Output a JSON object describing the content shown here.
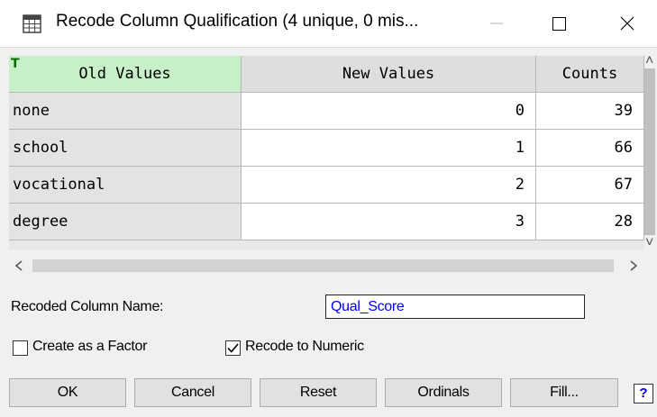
{
  "window": {
    "title": "Recode Column Qualification (4 unique, 0 mis...",
    "icons": {
      "app": "table-icon",
      "minimize": "minimize-icon",
      "maximize": "maximize-icon",
      "close": "close-icon"
    }
  },
  "grid": {
    "headers": {
      "old": "Old Values",
      "new": "New Values",
      "counts": "Counts"
    },
    "type_marker": "T",
    "rows": [
      {
        "old": "none",
        "new": "0",
        "count": "39"
      },
      {
        "old": "school",
        "new": "1",
        "count": "66"
      },
      {
        "old": "vocational",
        "new": "2",
        "count": "67"
      },
      {
        "old": "degree",
        "new": "3",
        "count": "28"
      }
    ]
  },
  "form": {
    "recoded_name_label": "Recoded Column Name:",
    "recoded_name_value": "Qual_Score",
    "create_factor_label": "Create as a Factor",
    "create_factor_checked": false,
    "recode_numeric_label": "Recode to Numeric",
    "recode_numeric_checked": true
  },
  "buttons": {
    "ok": "OK",
    "cancel": "Cancel",
    "reset": "Reset",
    "ordinals": "Ordinals",
    "fill": "Fill...",
    "help": "?"
  },
  "colors": {
    "header_old": "#c8f0c8",
    "input_text": "#0000ff",
    "type_marker": "#0a6b0a"
  }
}
